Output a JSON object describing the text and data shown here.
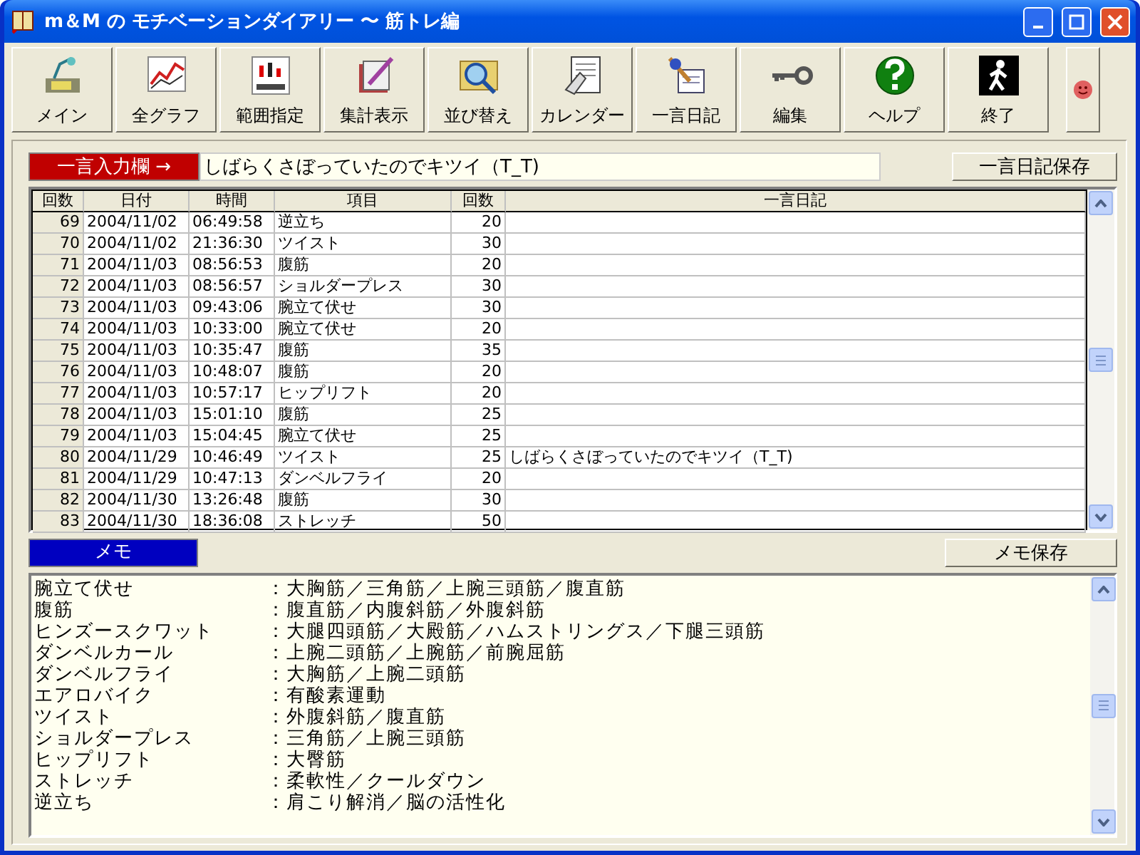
{
  "window": {
    "title": "m＆M の モチベーションダイアリー 〜 筋トレ編"
  },
  "toolbar": [
    {
      "label": "メイン"
    },
    {
      "label": "全グラフ"
    },
    {
      "label": "範囲指定"
    },
    {
      "label": "集計表示"
    },
    {
      "label": "並び替え"
    },
    {
      "label": "カレンダー"
    },
    {
      "label": "一言日記"
    },
    {
      "label": "編集"
    },
    {
      "label": "ヘルプ"
    },
    {
      "label": "終了"
    }
  ],
  "diary_input": {
    "label": "一言入力欄 →",
    "value": "しばらくさぼっていたのでキツイ（T_T)",
    "save_button": "一言日記保存"
  },
  "table": {
    "columns": [
      "回数",
      "日付",
      "時間",
      "項目",
      "回数",
      "一言日記"
    ],
    "rows": [
      [
        "69",
        "2004/11/02",
        "06:49:58",
        "逆立ち",
        "20",
        ""
      ],
      [
        "70",
        "2004/11/02",
        "21:36:30",
        "ツイスト",
        "30",
        ""
      ],
      [
        "71",
        "2004/11/03",
        "08:56:53",
        "腹筋",
        "20",
        ""
      ],
      [
        "72",
        "2004/11/03",
        "08:56:57",
        "ショルダープレス",
        "30",
        ""
      ],
      [
        "73",
        "2004/11/03",
        "09:43:06",
        "腕立て伏せ",
        "30",
        ""
      ],
      [
        "74",
        "2004/11/03",
        "10:33:00",
        "腕立て伏せ",
        "20",
        ""
      ],
      [
        "75",
        "2004/11/03",
        "10:35:47",
        "腹筋",
        "35",
        ""
      ],
      [
        "76",
        "2004/11/03",
        "10:48:07",
        "腹筋",
        "20",
        ""
      ],
      [
        "77",
        "2004/11/03",
        "10:57:17",
        "ヒップリフト",
        "20",
        ""
      ],
      [
        "78",
        "2004/11/03",
        "15:01:10",
        "腹筋",
        "25",
        ""
      ],
      [
        "79",
        "2004/11/03",
        "15:04:45",
        "腕立て伏せ",
        "25",
        ""
      ],
      [
        "80",
        "2004/11/29",
        "10:46:49",
        "ツイスト",
        "25",
        "しばらくさぼっていたのでキツイ（T_T)"
      ],
      [
        "81",
        "2004/11/29",
        "10:47:13",
        "ダンベルフライ",
        "20",
        ""
      ],
      [
        "82",
        "2004/11/30",
        "13:26:48",
        "腹筋",
        "30",
        ""
      ],
      [
        "83",
        "2004/11/30",
        "18:36:08",
        "ストレッチ",
        "50",
        ""
      ]
    ]
  },
  "memo": {
    "label": "メモ",
    "save_button": "メモ保存",
    "lines": [
      {
        "item": "腕立て伏せ",
        "detail": "：大胸筋／三角筋／上腕三頭筋／腹直筋"
      },
      {
        "item": "腹筋",
        "detail": "：腹直筋／内腹斜筋／外腹斜筋"
      },
      {
        "item": "ヒンズースクワット",
        "detail": "：大腿四頭筋／大殿筋／ハムストリングス／下腿三頭筋"
      },
      {
        "item": "ダンベルカール",
        "detail": "：上腕二頭筋／上腕筋／前腕屈筋"
      },
      {
        "item": "ダンベルフライ",
        "detail": "：大胸筋／上腕二頭筋"
      },
      {
        "item": "エアロバイク",
        "detail": "：有酸素運動"
      },
      {
        "item": "ツイスト",
        "detail": "：外腹斜筋／腹直筋"
      },
      {
        "item": "ショルダープレス",
        "detail": "：三角筋／上腕三頭筋"
      },
      {
        "item": "ヒップリフト",
        "detail": "：大臀筋"
      },
      {
        "item": "ストレッチ",
        "detail": "：柔軟性／クールダウン"
      },
      {
        "item": "逆立ち",
        "detail": "：肩こり解消／脳の活性化"
      }
    ]
  }
}
